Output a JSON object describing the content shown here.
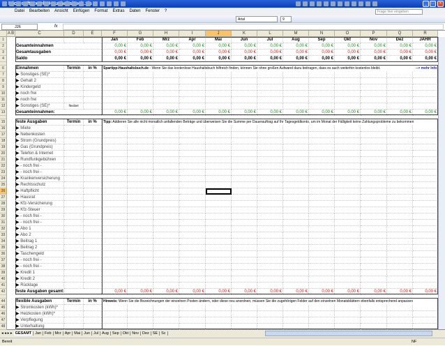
{
  "window": {
    "title": "Microsoft Excel - Haushaltsbuch.xls"
  },
  "menu": [
    "Datei",
    "Bearbeiten",
    "Ansicht",
    "Einfügen",
    "Format",
    "Extras",
    "Daten",
    "Fenster",
    "?"
  ],
  "help_placeholder": "Frage hier eingeben",
  "font": {
    "name": "Arial",
    "size": "9"
  },
  "namebox": "J26",
  "fx": "fx",
  "columns": [
    "A B",
    "C",
    "D",
    "E",
    "F",
    "G",
    "H",
    "I",
    "J",
    "K",
    "L",
    "M",
    "N",
    "O",
    "P",
    "Q",
    "R"
  ],
  "months": [
    "Jan",
    "Feb",
    "Mrz",
    "Apr",
    "Mai",
    "Jun",
    "Jul",
    "Aug",
    "Sep",
    "Okt",
    "Nov",
    "Dez",
    "JAHR"
  ],
  "zero": "0,00 €",
  "summary": [
    {
      "label": "Gesamteinnahmen",
      "color": "green"
    },
    {
      "label": "Gesamtausgaben",
      "color": "red"
    },
    {
      "label": "Saldo",
      "color": "black"
    }
  ],
  "income": {
    "title": "Einnahmen",
    "termin": "Termin",
    "pct": "in %",
    "tip_bold": "Spartipp-Haushaltsbuch.de",
    "tip": " - Wenn Sie das kostenlose Haushaltsbuch hilfreich finden, können Sie ohne großen Aufwand dazu beitragen, dass es auch weiterhin kostenlos bleibt.",
    "more": "--> mehr Info",
    "items": [
      "Sonstiges (SE)*",
      "Gehalt 2",
      "Kindergeld",
      "noch frei",
      "noch frei",
      "Sonstiges (SE)*"
    ],
    "termin_value": "flexibel",
    "total": "Gesamteinnahmen:"
  },
  "fixed": {
    "title": "feste Ausgaben",
    "termin": "Termin",
    "pct": "in %",
    "tip_bold": "Tipp:",
    "tip": " Addieren Sie alle nicht monatlich anfallenden Beträge und überweisen Sie die Summe per Dauerauftrag auf Ihr Tagesgeldkonto, um im Monat der Fälligkeit keine Zahlungsprobleme zu bekommen",
    "items": [
      "Miete",
      "Nebenkosten",
      "Strom (Grundpreis)",
      "Gas (Grundpreis)",
      "Telefon & Internet",
      "Rundfunkgebühren",
      "- noch frei -",
      "- noch frei -",
      "Krankenversicherung",
      "Rechtsschutz",
      "Haftpflicht",
      "Hausrat",
      "Kfz-Versicherung",
      "Kfz-Steuer",
      "- noch frei -",
      "- noch frei -",
      "Abo 1",
      "Abo 2",
      "Beitrag 1",
      "Beitrag 2",
      "Taschengeld",
      "- noch frei -",
      "- noch frei -",
      "Kredit 1",
      "Kredit 2",
      "Rücklage"
    ],
    "total": "feste Ausgaben gesamt:"
  },
  "flex": {
    "title": "flexible Ausgaben",
    "termin": "Termin",
    "pct": "in %",
    "tip_bold": "Hinweis:",
    "tip": " Wenn Sie die Bezeichnungen der einzelnen Posten ändern, oder diese neu anordnen, müssen Sie die zugehörigen Felder auf den einzelnen Monatsblättern ebenfalls entsprechend anpassen",
    "items": [
      "Stromkosten (kWh)*",
      "Heizkosten (kWh)*",
      "Verpflegung",
      "Unterhaltung"
    ]
  },
  "sheets": [
    "GESAMT",
    "Jan",
    "Feb",
    "Mrz",
    "Apr",
    "Mai",
    "Jun",
    "Jul",
    "Aug",
    "Sep",
    "Okt",
    "Nov",
    "Dez",
    "SE",
    "Sc"
  ],
  "active_sheet": "GESAMT",
  "status": {
    "left": "Bereit",
    "right": "NF"
  },
  "colors": {
    "title": "#0a3fb8",
    "green": "#1a8a1a",
    "red": "#d01818",
    "selected_header": "#f9c36b"
  }
}
